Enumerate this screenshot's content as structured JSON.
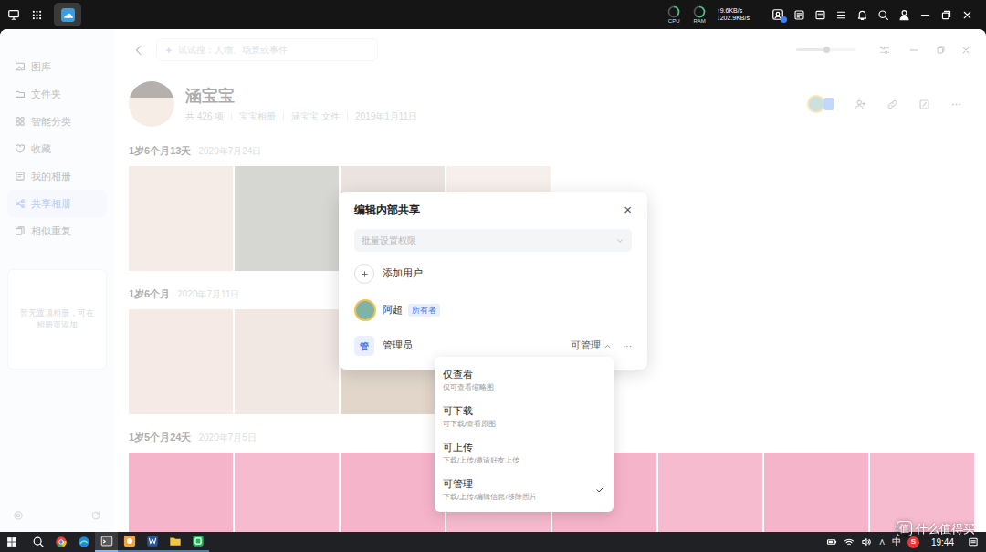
{
  "top_bar": {
    "cpu": {
      "label": "CPU",
      "level": 0.35
    },
    "ram": {
      "label": "RAM",
      "level": 0.6
    },
    "upload": "↑9.6KB/s",
    "download": "↓202.9KB/s"
  },
  "sidebar": {
    "items": [
      {
        "label": "图库",
        "selected": false
      },
      {
        "label": "文件夹",
        "selected": false
      },
      {
        "label": "智能分类",
        "selected": false
      },
      {
        "label": "收藏",
        "selected": false
      },
      {
        "label": "我的相册",
        "selected": false
      },
      {
        "label": "共享相册",
        "selected": true
      },
      {
        "label": "相似重复",
        "selected": false
      }
    ],
    "note": "暂无置顶相册，可在相册页添加"
  },
  "search": {
    "placeholder": "试试搜：人物、场景或事件"
  },
  "zoom": {
    "level": 0.5
  },
  "album": {
    "title": "涵宝宝",
    "meta": [
      "共 426 项",
      "宝宝相册",
      "涵宝宝 文件",
      "2019年1月11日"
    ]
  },
  "sections": [
    {
      "label": "1岁6个月13天",
      "date": "2020年7月24日"
    },
    {
      "label": "1岁6个月",
      "date": "2020年7月11日"
    },
    {
      "label": "1岁5个月24天",
      "date": "2020年7月5日"
    }
  ],
  "share_dialog": {
    "title": "编辑内部共享",
    "close": "×",
    "batch_placeholder": "批量设置权限",
    "add_user": "添加用户",
    "members": [
      {
        "kind": "user",
        "name": "阿超",
        "badge": "所有者"
      },
      {
        "kind": "group",
        "icon_text": "管",
        "name": "管理员",
        "permission": "可管理",
        "expanded": true,
        "more": "···"
      }
    ]
  },
  "permission_menu": [
    {
      "label": "仅查看",
      "description": "仅可查看缩略图",
      "selected": false
    },
    {
      "label": "可下载",
      "description": "可下载/查看原图",
      "selected": false
    },
    {
      "label": "可上传",
      "description": "下载/上传/邀请好友上传",
      "selected": false
    },
    {
      "label": "可管理",
      "description": "下载/上传/编辑信息/移除照片",
      "selected": true
    }
  ],
  "taskbar": {
    "tray": [
      {
        "kind": "text",
        "label": "∧"
      },
      {
        "kind": "text",
        "label": "中"
      },
      {
        "kind": "badge",
        "label": "S"
      }
    ],
    "time": "19:44"
  },
  "watermark": {
    "icon": "值",
    "text": "什么值得买"
  }
}
